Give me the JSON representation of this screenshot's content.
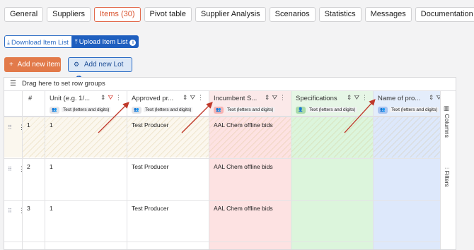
{
  "tabs": [
    {
      "label": "General",
      "active": false
    },
    {
      "label": "Suppliers",
      "active": false
    },
    {
      "label": "Items (30)",
      "active": true
    },
    {
      "label": "Pivot table",
      "active": false
    },
    {
      "label": "Supplier Analysis",
      "active": false
    },
    {
      "label": "Scenarios",
      "active": false
    },
    {
      "label": "Statistics",
      "active": false
    },
    {
      "label": "Messages",
      "active": false
    },
    {
      "label": "Documentation",
      "active": false
    }
  ],
  "toolbar": {
    "download_label": "Download Item List",
    "upload_label": "Upload Item List",
    "info_glyph": "i",
    "add_item_label": "Add new item",
    "add_lot_label": "Add new Lot"
  },
  "grid": {
    "group_bar_label": "Drag here to set row groups",
    "side_tabs": {
      "columns": "Columns",
      "filters": "Filters"
    },
    "columns": [
      {
        "key": "num",
        "title": "#",
        "badge": ""
      },
      {
        "key": "unit",
        "title": "Unit (e.g. 1/...",
        "badge": "Text (letters and digits)",
        "color": "#ffffff"
      },
      {
        "key": "approved",
        "title": "Approved pr...",
        "badge": "Text (letters and digits)",
        "color": "#ffffff"
      },
      {
        "key": "incumbent",
        "title": "Incumbent S...",
        "badge": "Text (letters and digits)",
        "color": "#fde2e2"
      },
      {
        "key": "specs",
        "title": "Specifications",
        "badge": "Text (letters and digits)",
        "color": "#dcf5dc"
      },
      {
        "key": "name",
        "title": "Name of pro...",
        "badge": "Text (letters and digits)",
        "color": "#dde8fb"
      }
    ],
    "rows": [
      {
        "num": "1",
        "unit": "1",
        "approved": "Test Producer",
        "incumbent": "AAL Chem offline bids",
        "specs": "",
        "name": ""
      },
      {
        "num": "2",
        "unit": "1",
        "approved": "Test Producer",
        "incumbent": "AAL Chem offline bids",
        "specs": "",
        "name": ""
      },
      {
        "num": "3",
        "unit": "1",
        "approved": "Test Producer",
        "incumbent": "AAL Chem offline bids",
        "specs": "",
        "name": ""
      }
    ]
  },
  "colors": {
    "accent_orange": "#e27a4a",
    "primary_blue": "#1f5fbf",
    "annotation_arrow": "#c0392b"
  }
}
